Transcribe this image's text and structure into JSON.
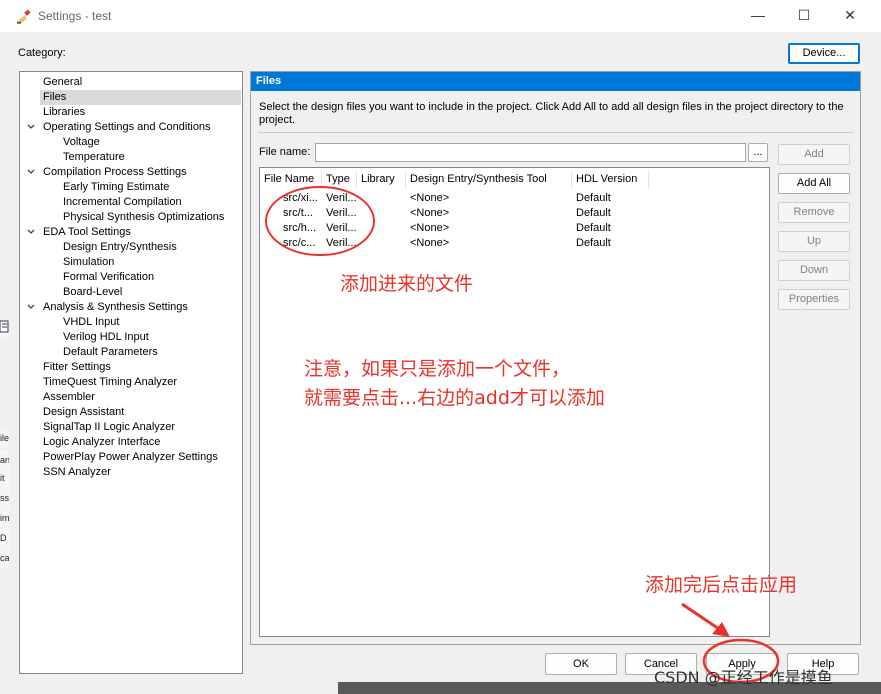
{
  "window": {
    "title": "Settings - test",
    "minimize": "—",
    "maximize": "☐",
    "close": "✕"
  },
  "category_label": "Category:",
  "device_button": "Device...",
  "tree": [
    {
      "label": "General",
      "chevron": false,
      "indent": 0,
      "selected": false
    },
    {
      "label": "Files",
      "chevron": false,
      "indent": 0,
      "selected": true
    },
    {
      "label": "Libraries",
      "chevron": false,
      "indent": 0,
      "selected": false
    },
    {
      "label": "Operating Settings and Conditions",
      "chevron": true,
      "indent": 0,
      "selected": false
    },
    {
      "label": "Voltage",
      "chevron": false,
      "indent": 1,
      "selected": false
    },
    {
      "label": "Temperature",
      "chevron": false,
      "indent": 1,
      "selected": false
    },
    {
      "label": "Compilation Process Settings",
      "chevron": true,
      "indent": 0,
      "selected": false
    },
    {
      "label": "Early Timing Estimate",
      "chevron": false,
      "indent": 1,
      "selected": false
    },
    {
      "label": "Incremental Compilation",
      "chevron": false,
      "indent": 1,
      "selected": false
    },
    {
      "label": "Physical Synthesis Optimizations",
      "chevron": false,
      "indent": 1,
      "selected": false
    },
    {
      "label": "EDA Tool Settings",
      "chevron": true,
      "indent": 0,
      "selected": false
    },
    {
      "label": "Design Entry/Synthesis",
      "chevron": false,
      "indent": 1,
      "selected": false
    },
    {
      "label": "Simulation",
      "chevron": false,
      "indent": 1,
      "selected": false
    },
    {
      "label": "Formal Verification",
      "chevron": false,
      "indent": 1,
      "selected": false
    },
    {
      "label": "Board-Level",
      "chevron": false,
      "indent": 1,
      "selected": false
    },
    {
      "label": "Analysis & Synthesis Settings",
      "chevron": true,
      "indent": 0,
      "selected": false
    },
    {
      "label": "VHDL Input",
      "chevron": false,
      "indent": 1,
      "selected": false
    },
    {
      "label": "Verilog HDL Input",
      "chevron": false,
      "indent": 1,
      "selected": false
    },
    {
      "label": "Default Parameters",
      "chevron": false,
      "indent": 1,
      "selected": false
    },
    {
      "label": "Fitter Settings",
      "chevron": false,
      "indent": 0,
      "selected": false
    },
    {
      "label": "TimeQuest Timing Analyzer",
      "chevron": false,
      "indent": 0,
      "selected": false
    },
    {
      "label": "Assembler",
      "chevron": false,
      "indent": 0,
      "selected": false
    },
    {
      "label": "Design Assistant",
      "chevron": false,
      "indent": 0,
      "selected": false
    },
    {
      "label": "SignalTap II Logic Analyzer",
      "chevron": false,
      "indent": 0,
      "selected": false
    },
    {
      "label": "Logic Analyzer Interface",
      "chevron": false,
      "indent": 0,
      "selected": false
    },
    {
      "label": "PowerPlay Power Analyzer Settings",
      "chevron": false,
      "indent": 0,
      "selected": false
    },
    {
      "label": "SSN Analyzer",
      "chevron": false,
      "indent": 0,
      "selected": false
    }
  ],
  "panel": {
    "header": "Files",
    "description": "Select the design files you want to include in the project. Click Add All to add all design files in the project directory to the project.",
    "file_name_label": "File name:",
    "file_name_value": "",
    "browse_button": "...",
    "columns": [
      "File Name",
      "Type",
      "Library",
      "Design Entry/Synthesis Tool",
      "HDL Version"
    ],
    "rows": [
      {
        "file": "src/xi...",
        "type": "Veril...",
        "library": "",
        "tool": "<None>",
        "hdl": "Default"
      },
      {
        "file": "src/t...",
        "type": "Veril...",
        "library": "",
        "tool": "<None>",
        "hdl": "Default"
      },
      {
        "file": "src/h...",
        "type": "Veril...",
        "library": "",
        "tool": "<None>",
        "hdl": "Default"
      },
      {
        "file": "src/c...",
        "type": "Veril...",
        "library": "",
        "tool": "<None>",
        "hdl": "Default"
      }
    ],
    "side_buttons": [
      {
        "label": "Add",
        "enabled": false
      },
      {
        "label": "Add All",
        "enabled": true
      },
      {
        "label": "Remove",
        "enabled": false
      },
      {
        "label": "Up",
        "enabled": false
      },
      {
        "label": "Down",
        "enabled": false
      },
      {
        "label": "Properties",
        "enabled": false
      }
    ]
  },
  "footer": {
    "ok": "OK",
    "cancel": "Cancel",
    "apply": "Apply",
    "help": "Help"
  },
  "annotations": {
    "added_files": "添加进来的文件",
    "note_line1": "注意，如果只是添加一个文件，",
    "note_line2": "就需要点击...右边的add才可以添加",
    "after_add": "添加完后点击应用"
  },
  "watermark": "CSDN @正经工作是摸鱼",
  "left_edge_fragments": [
    "ile",
    "an",
    "it",
    "ss",
    "im",
    "D",
    "ca"
  ],
  "colors": {
    "accent": "#0078d7",
    "annotation_red": "#e8332a"
  }
}
